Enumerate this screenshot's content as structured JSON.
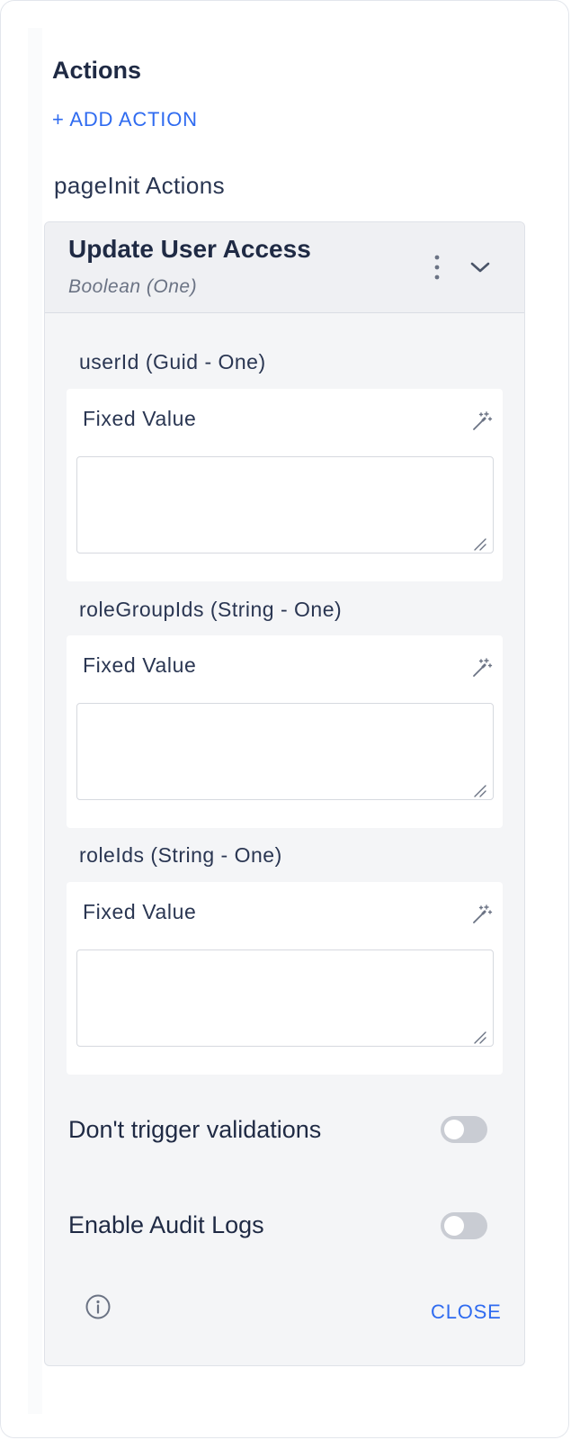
{
  "panel": {
    "title": "Actions",
    "add_action_label": "+ ADD ACTION",
    "group_title": "pageInit Actions"
  },
  "action": {
    "title": "Update User Access",
    "subtitle": "Boolean (One)",
    "icons": {
      "menu": "kebab-menu-icon",
      "expand": "chevron-down-icon"
    },
    "params": [
      {
        "label": "userId (Guid - One)",
        "mode_label": "Fixed Value",
        "value": "",
        "icon": "magic-wand-icon"
      },
      {
        "label": "roleGroupIds (String - One)",
        "mode_label": "Fixed Value",
        "value": "",
        "icon": "magic-wand-icon"
      },
      {
        "label": "roleIds (String - One)",
        "mode_label": "Fixed Value",
        "value": "",
        "icon": "magic-wand-icon"
      }
    ],
    "toggles": [
      {
        "label": "Don't trigger validations",
        "on": false
      },
      {
        "label": "Enable Audit Logs",
        "on": false
      }
    ],
    "footer": {
      "info_icon": "info-icon",
      "close_label": "CLOSE"
    }
  },
  "colors": {
    "accent": "#2f6bf0",
    "text": "#1f2a44",
    "card_bg": "#f4f5f7",
    "toggle_off": "#c9ccd3"
  }
}
